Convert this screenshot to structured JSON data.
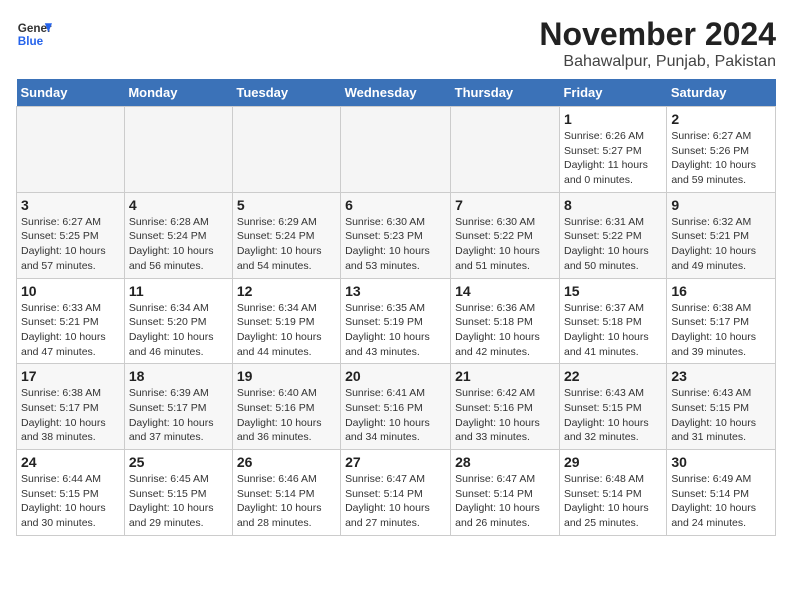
{
  "logo": {
    "line1": "General",
    "line2": "Blue"
  },
  "title": "November 2024",
  "location": "Bahawalpur, Punjab, Pakistan",
  "weekdays": [
    "Sunday",
    "Monday",
    "Tuesday",
    "Wednesday",
    "Thursday",
    "Friday",
    "Saturday"
  ],
  "weeks": [
    [
      {
        "day": "",
        "info": ""
      },
      {
        "day": "",
        "info": ""
      },
      {
        "day": "",
        "info": ""
      },
      {
        "day": "",
        "info": ""
      },
      {
        "day": "",
        "info": ""
      },
      {
        "day": "1",
        "info": "Sunrise: 6:26 AM\nSunset: 5:27 PM\nDaylight: 11 hours\nand 0 minutes."
      },
      {
        "day": "2",
        "info": "Sunrise: 6:27 AM\nSunset: 5:26 PM\nDaylight: 10 hours\nand 59 minutes."
      }
    ],
    [
      {
        "day": "3",
        "info": "Sunrise: 6:27 AM\nSunset: 5:25 PM\nDaylight: 10 hours\nand 57 minutes."
      },
      {
        "day": "4",
        "info": "Sunrise: 6:28 AM\nSunset: 5:24 PM\nDaylight: 10 hours\nand 56 minutes."
      },
      {
        "day": "5",
        "info": "Sunrise: 6:29 AM\nSunset: 5:24 PM\nDaylight: 10 hours\nand 54 minutes."
      },
      {
        "day": "6",
        "info": "Sunrise: 6:30 AM\nSunset: 5:23 PM\nDaylight: 10 hours\nand 53 minutes."
      },
      {
        "day": "7",
        "info": "Sunrise: 6:30 AM\nSunset: 5:22 PM\nDaylight: 10 hours\nand 51 minutes."
      },
      {
        "day": "8",
        "info": "Sunrise: 6:31 AM\nSunset: 5:22 PM\nDaylight: 10 hours\nand 50 minutes."
      },
      {
        "day": "9",
        "info": "Sunrise: 6:32 AM\nSunset: 5:21 PM\nDaylight: 10 hours\nand 49 minutes."
      }
    ],
    [
      {
        "day": "10",
        "info": "Sunrise: 6:33 AM\nSunset: 5:21 PM\nDaylight: 10 hours\nand 47 minutes."
      },
      {
        "day": "11",
        "info": "Sunrise: 6:34 AM\nSunset: 5:20 PM\nDaylight: 10 hours\nand 46 minutes."
      },
      {
        "day": "12",
        "info": "Sunrise: 6:34 AM\nSunset: 5:19 PM\nDaylight: 10 hours\nand 44 minutes."
      },
      {
        "day": "13",
        "info": "Sunrise: 6:35 AM\nSunset: 5:19 PM\nDaylight: 10 hours\nand 43 minutes."
      },
      {
        "day": "14",
        "info": "Sunrise: 6:36 AM\nSunset: 5:18 PM\nDaylight: 10 hours\nand 42 minutes."
      },
      {
        "day": "15",
        "info": "Sunrise: 6:37 AM\nSunset: 5:18 PM\nDaylight: 10 hours\nand 41 minutes."
      },
      {
        "day": "16",
        "info": "Sunrise: 6:38 AM\nSunset: 5:17 PM\nDaylight: 10 hours\nand 39 minutes."
      }
    ],
    [
      {
        "day": "17",
        "info": "Sunrise: 6:38 AM\nSunset: 5:17 PM\nDaylight: 10 hours\nand 38 minutes."
      },
      {
        "day": "18",
        "info": "Sunrise: 6:39 AM\nSunset: 5:17 PM\nDaylight: 10 hours\nand 37 minutes."
      },
      {
        "day": "19",
        "info": "Sunrise: 6:40 AM\nSunset: 5:16 PM\nDaylight: 10 hours\nand 36 minutes."
      },
      {
        "day": "20",
        "info": "Sunrise: 6:41 AM\nSunset: 5:16 PM\nDaylight: 10 hours\nand 34 minutes."
      },
      {
        "day": "21",
        "info": "Sunrise: 6:42 AM\nSunset: 5:16 PM\nDaylight: 10 hours\nand 33 minutes."
      },
      {
        "day": "22",
        "info": "Sunrise: 6:43 AM\nSunset: 5:15 PM\nDaylight: 10 hours\nand 32 minutes."
      },
      {
        "day": "23",
        "info": "Sunrise: 6:43 AM\nSunset: 5:15 PM\nDaylight: 10 hours\nand 31 minutes."
      }
    ],
    [
      {
        "day": "24",
        "info": "Sunrise: 6:44 AM\nSunset: 5:15 PM\nDaylight: 10 hours\nand 30 minutes."
      },
      {
        "day": "25",
        "info": "Sunrise: 6:45 AM\nSunset: 5:15 PM\nDaylight: 10 hours\nand 29 minutes."
      },
      {
        "day": "26",
        "info": "Sunrise: 6:46 AM\nSunset: 5:14 PM\nDaylight: 10 hours\nand 28 minutes."
      },
      {
        "day": "27",
        "info": "Sunrise: 6:47 AM\nSunset: 5:14 PM\nDaylight: 10 hours\nand 27 minutes."
      },
      {
        "day": "28",
        "info": "Sunrise: 6:47 AM\nSunset: 5:14 PM\nDaylight: 10 hours\nand 26 minutes."
      },
      {
        "day": "29",
        "info": "Sunrise: 6:48 AM\nSunset: 5:14 PM\nDaylight: 10 hours\nand 25 minutes."
      },
      {
        "day": "30",
        "info": "Sunrise: 6:49 AM\nSunset: 5:14 PM\nDaylight: 10 hours\nand 24 minutes."
      }
    ]
  ]
}
